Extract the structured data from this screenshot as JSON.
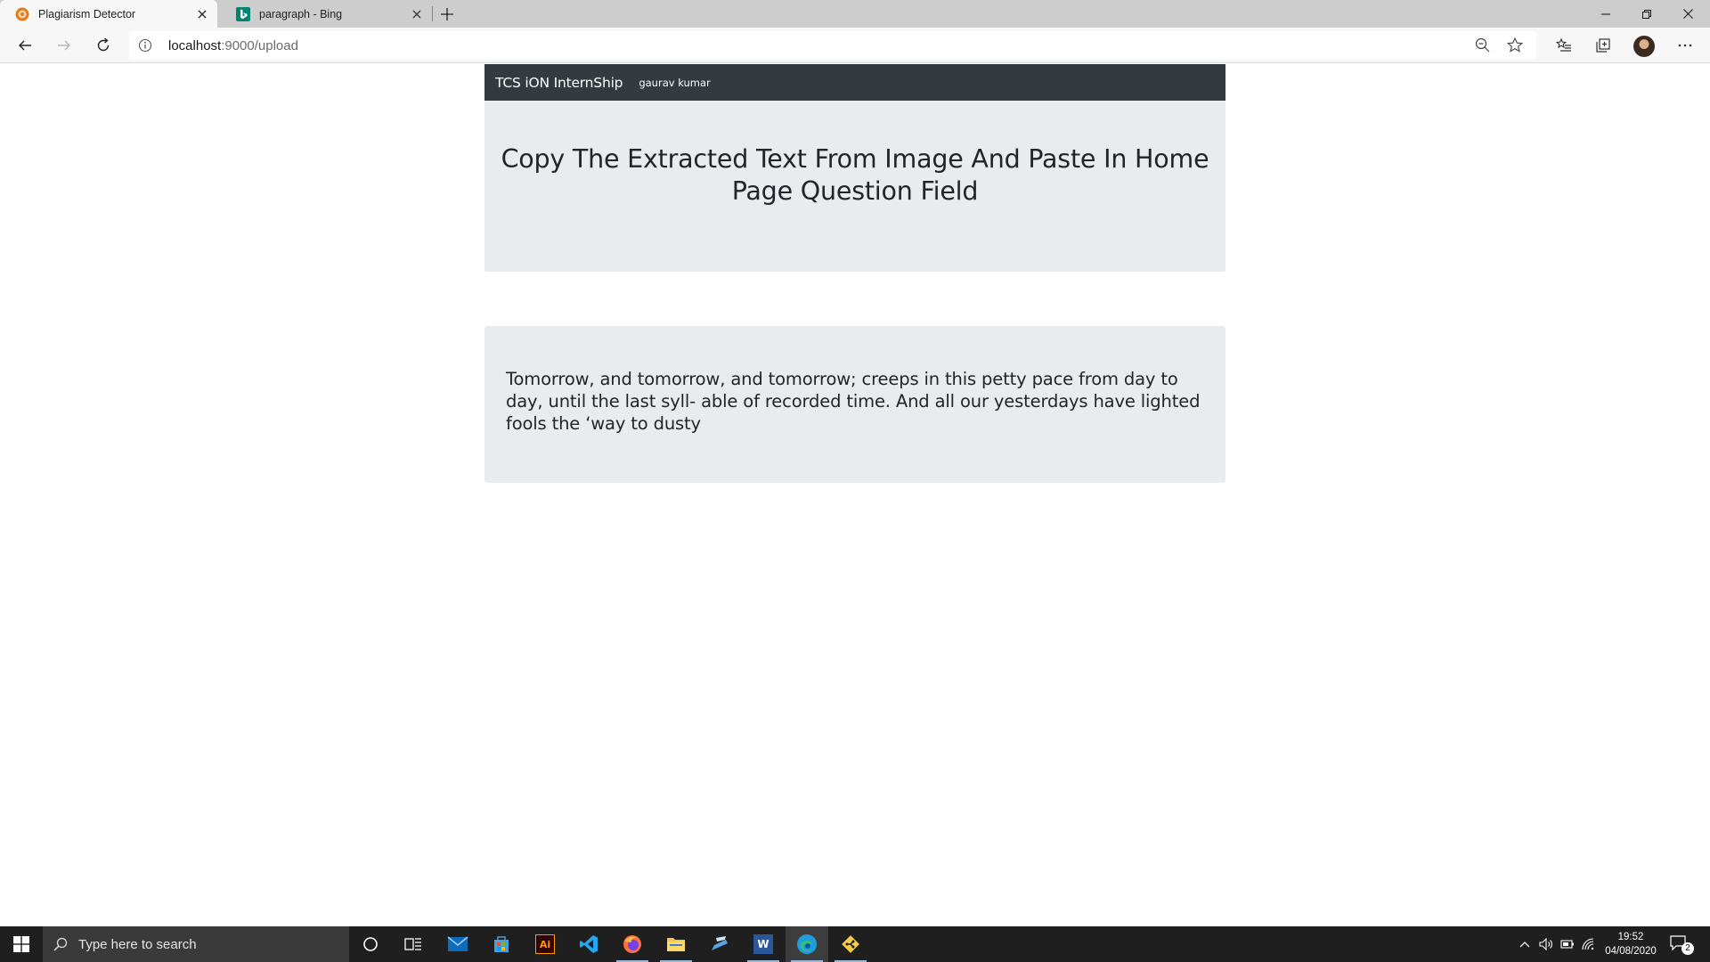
{
  "browser": {
    "tabs": [
      {
        "title": "Plagiarism Detector",
        "active": true,
        "favicon": "globe-orange-icon"
      },
      {
        "title": "paragraph - Bing",
        "active": false,
        "favicon": "bing-icon"
      }
    ],
    "address": {
      "host": "localhost",
      "path": ":9000/upload"
    },
    "colors": {
      "tabstrip": "#cdcdcd",
      "toolbar": "#f7f7f7"
    }
  },
  "page": {
    "navbar": {
      "brand": "TCS iON InternShip",
      "user_link": "gaurav kumar"
    },
    "jumbotron": {
      "heading": "Copy The Extracted Text From Image And Paste In Home Page Question Field"
    },
    "extracted_text": "Tomorrow, and tomorrow, and tomorrow; creeps in this petty pace from day to day, until the last syll- able of recorded time. And all our yesterdays have lighted fools the ‘way to dusty",
    "colors": {
      "navbar": "#343a40",
      "panel": "#e9ecef",
      "text": "#212529"
    }
  },
  "taskbar": {
    "search_placeholder": "Type here to search",
    "pinned_apps": [
      "cortana-icon",
      "task-view-icon",
      "mail-icon",
      "store-icon",
      "illustrator-icon",
      "vscode-icon",
      "firefox-icon",
      "file-explorer-icon",
      "anaconda-icon",
      "word-icon",
      "edge-icon",
      "git-icon"
    ],
    "illustrator_label": "Ai",
    "word_label": "W",
    "clock": {
      "time": "19:52",
      "date": "04/08/2020"
    },
    "notification_count": "2"
  }
}
